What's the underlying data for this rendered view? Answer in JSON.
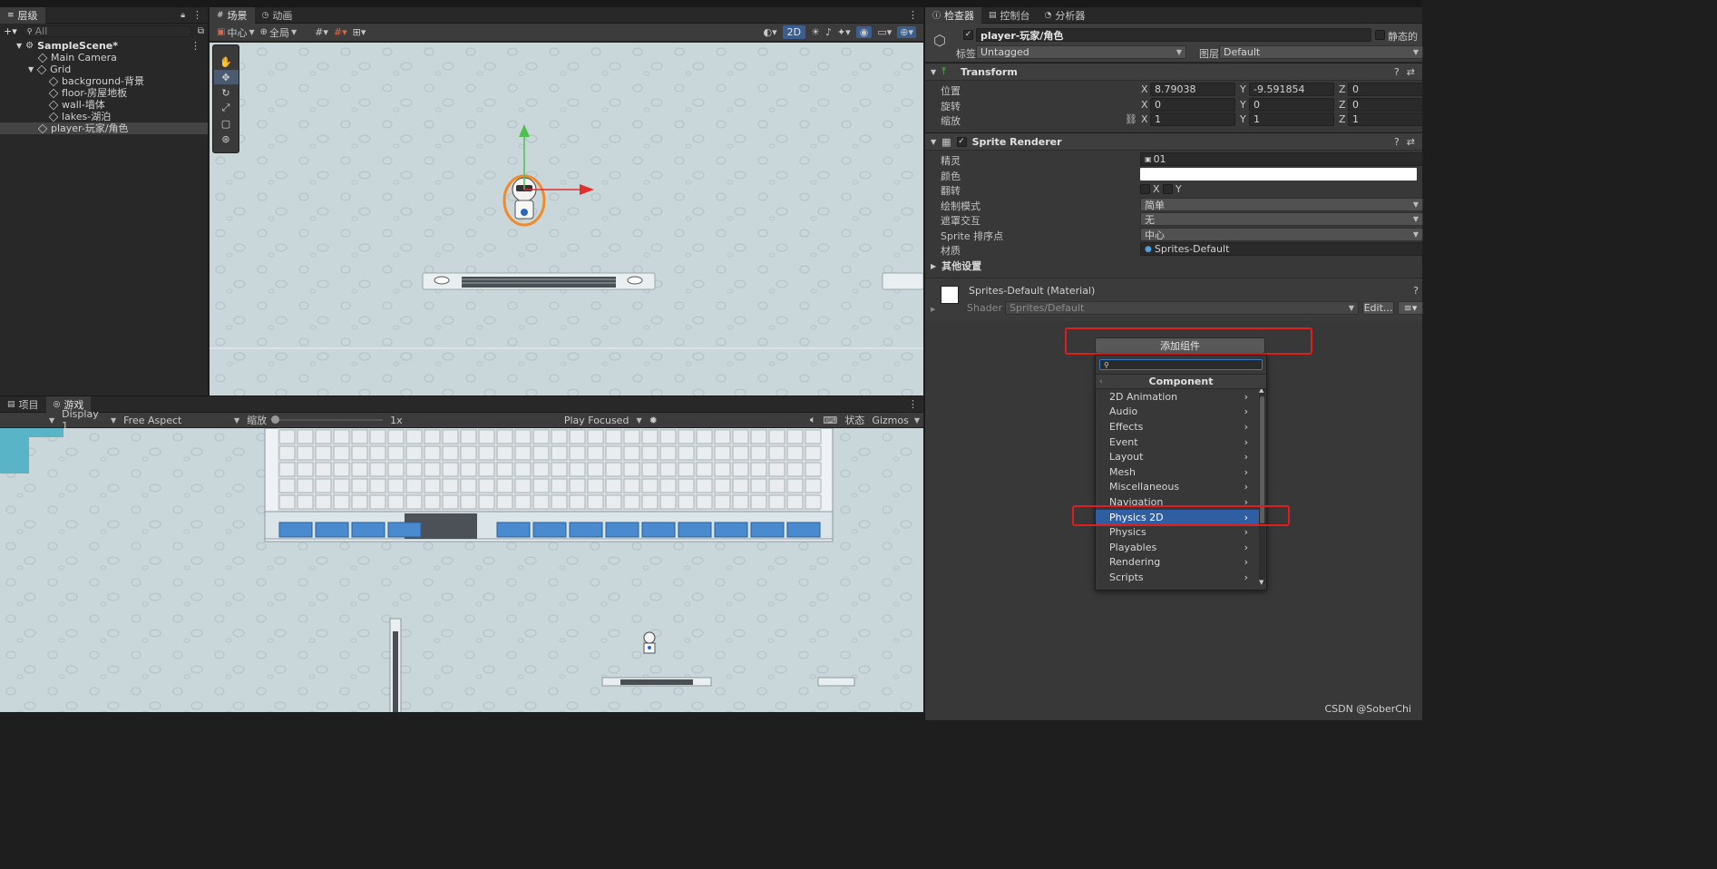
{
  "hierarchy": {
    "tab_label": "层级",
    "search_placeholder": "All",
    "scene_name": "SampleScene*",
    "items": [
      {
        "label": "Main Camera"
      },
      {
        "label": "Grid"
      },
      {
        "label": "background-背景"
      },
      {
        "label": "floor-房屋地板"
      },
      {
        "label": "wall-墙体"
      },
      {
        "label": "lakes-湖泊"
      },
      {
        "label": "player-玩家/角色"
      }
    ]
  },
  "scene_view": {
    "tabs": [
      {
        "label": "场景"
      },
      {
        "label": "动画"
      }
    ],
    "pivot_label": "中心",
    "space_label": "全局",
    "mode_2d_label": "2D"
  },
  "game_view": {
    "tabs": [
      {
        "label": "项目"
      },
      {
        "label": "游戏"
      }
    ],
    "display_label": "Display 1",
    "aspect_label": "Free Aspect",
    "scale_label": "缩放",
    "scale_value": "1x",
    "play_mode_label": "Play Focused",
    "stats_label": "状态",
    "gizmos_label": "Gizmos"
  },
  "inspector": {
    "tabs": [
      {
        "label": "检查器"
      },
      {
        "label": "控制台"
      },
      {
        "label": "分析器"
      }
    ],
    "object_name": "player-玩家/角色",
    "static_label": "静态的",
    "tag_label": "标签",
    "tag_value": "Untagged",
    "layer_label": "图层",
    "layer_value": "Default",
    "transform": {
      "title": "Transform",
      "position_label": "位置",
      "rotation_label": "旋转",
      "scale_label": "缩放",
      "position": {
        "x": "8.79038",
        "y": "-9.591854",
        "z": "0"
      },
      "rotation": {
        "x": "0",
        "y": "0",
        "z": "0"
      },
      "scale": {
        "x": "1",
        "y": "1",
        "z": "1"
      }
    },
    "sprite_renderer": {
      "title": "Sprite Renderer",
      "sprite_label": "精灵",
      "sprite_value": "01",
      "color_label": "颜色",
      "flip_label": "翻转",
      "flip_x": "X",
      "flip_y": "Y",
      "draw_mode_label": "绘制模式",
      "draw_mode_value": "简单",
      "mask_label": "遮罩交互",
      "mask_value": "无",
      "sort_point_label": "Sprite 排序点",
      "sort_point_value": "中心",
      "material_label": "材质",
      "material_value": "Sprites-Default",
      "other_settings_label": "其他设置"
    },
    "material": {
      "title": "Sprites-Default (Material)",
      "shader_label": "Shader",
      "shader_value": "Sprites/Default",
      "edit_label": "Edit..."
    },
    "add_component_label": "添加组件"
  },
  "component_menu": {
    "title": "Component",
    "items": [
      {
        "label": "2D Animation"
      },
      {
        "label": "Audio"
      },
      {
        "label": "Effects"
      },
      {
        "label": "Event"
      },
      {
        "label": "Layout"
      },
      {
        "label": "Mesh"
      },
      {
        "label": "Miscellaneous"
      },
      {
        "label": "Navigation"
      },
      {
        "label": "Physics 2D"
      },
      {
        "label": "Physics"
      },
      {
        "label": "Playables"
      },
      {
        "label": "Rendering"
      },
      {
        "label": "Scripts"
      }
    ],
    "selected": "Physics 2D"
  },
  "watermark": "CSDN @SoberChi",
  "colors": {
    "selection_blue": "#2f5ea3",
    "highlight_red": "#e01e1e",
    "scene_bg": "#c9d6da"
  }
}
